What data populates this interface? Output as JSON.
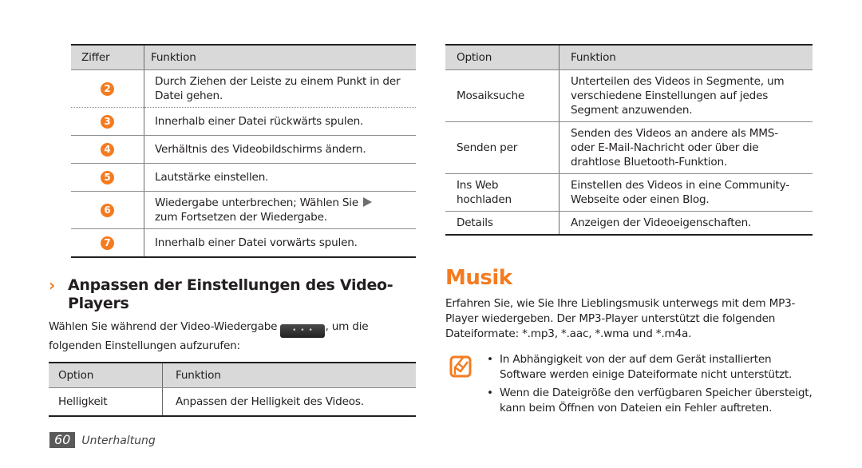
{
  "table_controls": {
    "headers": [
      "Ziffer",
      "Funktion"
    ],
    "rows": [
      {
        "num": "2",
        "text": "Durch Ziehen der Leiste zu einem Punkt in der Datei gehen."
      },
      {
        "num": "3",
        "text": "Innerhalb einer Datei rückwärts spulen."
      },
      {
        "num": "4",
        "text": "Verhältnis des Videobildschirms ändern."
      },
      {
        "num": "5",
        "text": "Lautstärke einstellen."
      },
      {
        "num": "6",
        "text_before": "Wiedergabe unterbrechen; Wählen Sie",
        "icon": "play-icon",
        "text_after": "zum Fortsetzen der Wiedergabe."
      },
      {
        "num": "7",
        "text": "Innerhalb einer Datei vorwärts spulen."
      }
    ]
  },
  "section": {
    "chevron": "›",
    "title": "Anpassen der Einstellungen des Video-Players",
    "intro_before": "Wählen Sie während der Video-Wiedergabe",
    "menu_button_label": "• • •",
    "intro_after": ", um die folgenden Einstellungen aufzurufen:"
  },
  "table_settings": {
    "headers": [
      "Option",
      "Funktion"
    ],
    "rows": [
      {
        "option": "Helligkeit",
        "function": "Anpassen der Helligkeit des Videos."
      }
    ]
  },
  "table_options": {
    "headers": [
      "Option",
      "Funktion"
    ],
    "rows": [
      {
        "option": "Mosaiksuche",
        "function": "Unterteilen des Videos in Segmente, um verschiedene Einstellungen auf jedes Segment anzuwenden."
      },
      {
        "option": "Senden per",
        "function": "Senden des Videos an andere als MMS- oder E-Mail-Nachricht oder über die drahtlose Bluetooth-Funktion."
      },
      {
        "option": "Ins Web hochladen",
        "function": "Einstellen des Videos in eine Community-Webseite oder einen Blog."
      },
      {
        "option": "Details",
        "function": "Anzeigen der Videoeigenschaften."
      }
    ]
  },
  "musik": {
    "title": "Musik",
    "intro": "Erfahren Sie, wie Sie Ihre Lieblingsmusik unterwegs mit dem MP3-Player wiedergeben. Der MP3-Player unterstützt die folgenden Dateiformate: *.mp3, *.aac, *.wma und *.m4a.",
    "note_icon": "note-pencil-icon",
    "notes": [
      "In Abhängigkeit von der auf dem Gerät installierten Software werden einige Dateiformate nicht unterstützt.",
      "Wenn die Dateigröße den verfügbaren Speicher übersteigt, kann beim Öffnen von Dateien ein Fehler auftreten."
    ]
  },
  "footer": {
    "page_number": "60",
    "section_name": "Unterhaltung"
  },
  "colors": {
    "accent": "#f47b20",
    "table_header_bg": "#d9d9d9",
    "text": "#231f20"
  }
}
